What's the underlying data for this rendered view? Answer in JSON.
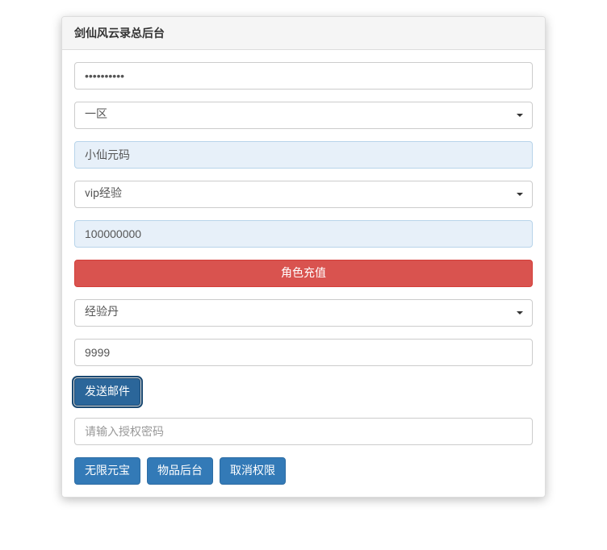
{
  "header": {
    "title": "剑仙风云录总后台"
  },
  "form": {
    "password_value": "••••••••••",
    "zone_select": "一区",
    "character_name": "小仙元码",
    "recharge_type": "vip经验",
    "recharge_amount": "100000000",
    "recharge_button": "角色充值",
    "item_select": "经验丹",
    "item_quantity": "9999",
    "send_mail_button": "发送邮件",
    "auth_password_placeholder": "请输入授权密码",
    "auth_password_value": "",
    "unlimited_gold_button": "无限元宝",
    "item_admin_button": "物品后台",
    "cancel_permission_button": "取消权限"
  }
}
